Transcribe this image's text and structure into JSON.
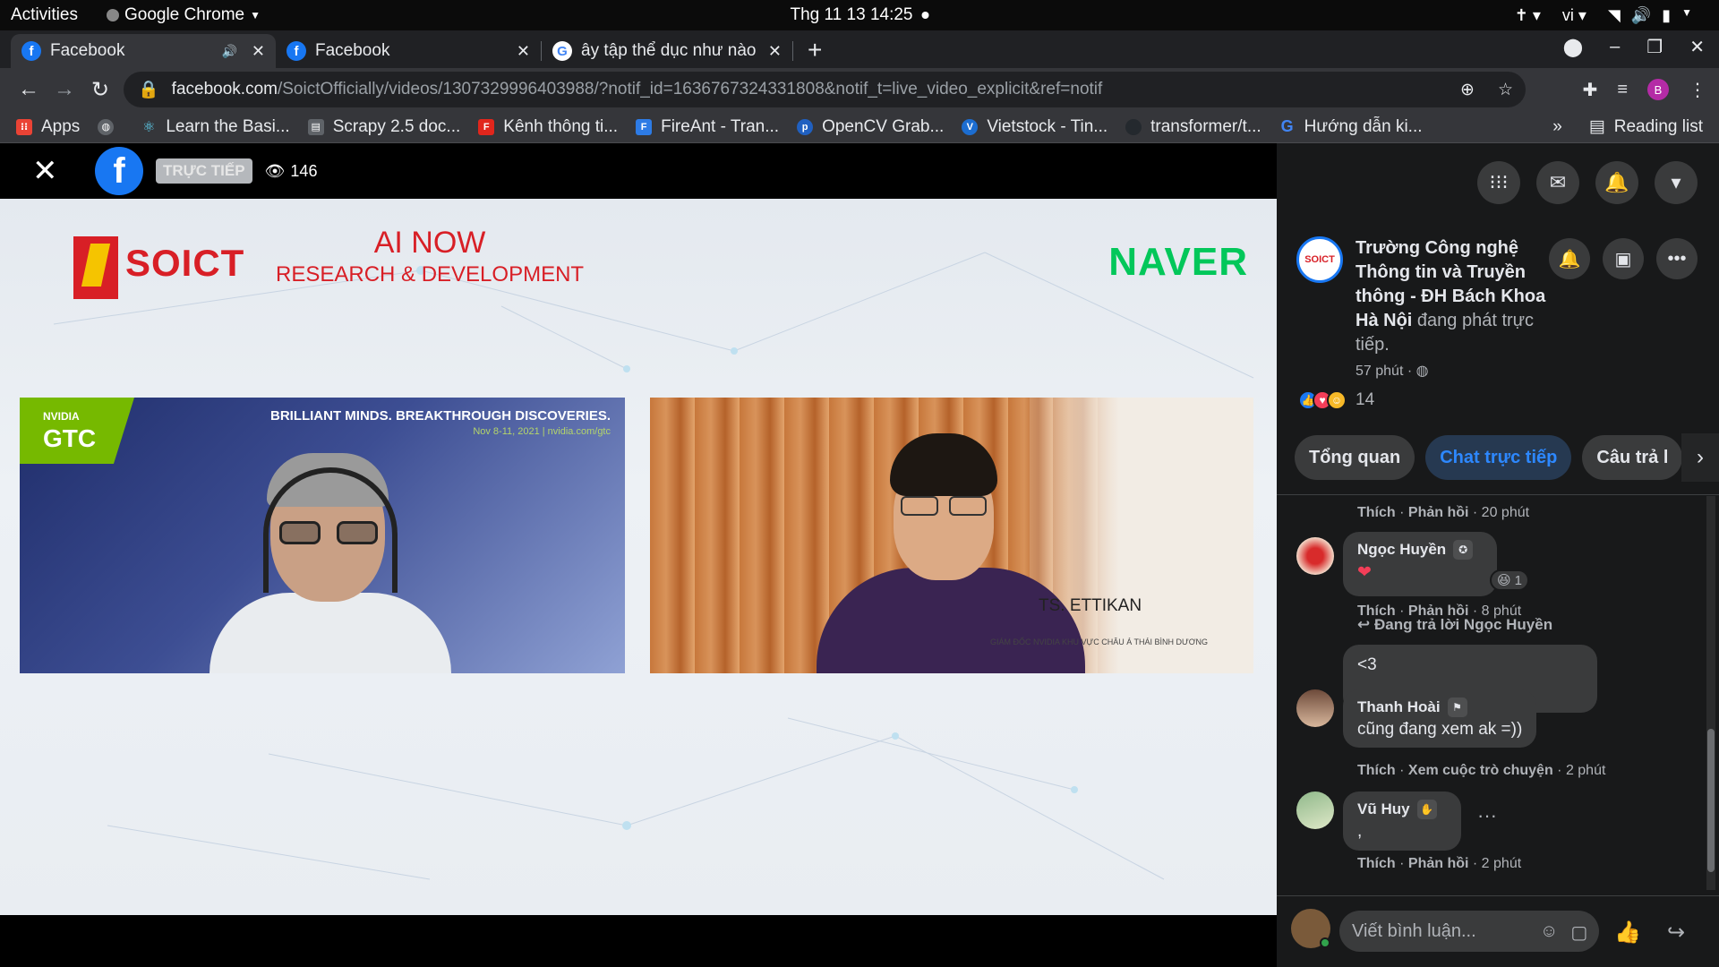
{
  "system": {
    "activities": "Activities",
    "app": "Google Chrome",
    "clock": "Thg 11 13  14:25",
    "lang": "vi"
  },
  "tabs": [
    {
      "title": "Facebook",
      "active": true
    },
    {
      "title": "Facebook",
      "active": false
    },
    {
      "title": "ây tập thể dục như nào l",
      "active": false
    }
  ],
  "address": {
    "host": "facebook.com",
    "path": "/SoictOfficially/videos/1307329996403988/?notif_id=1636767324331808&notif_t=live_video_explicit&ref=notif"
  },
  "profile_initial": "B",
  "bookmarks": [
    {
      "label": "Apps",
      "color": "#ea4335"
    },
    {
      "label": "",
      "color": "#5f6368"
    },
    {
      "label": "Learn the Basi...",
      "color": "#61dafb"
    },
    {
      "label": "Scrapy 2.5 doc...",
      "color": "#5f6368"
    },
    {
      "label": "Kênh thông ti...",
      "color": "#e1261c"
    },
    {
      "label": "FireAnt - Tran...",
      "color": "#2d7be5"
    },
    {
      "label": "OpenCV Grab...",
      "color": "#2060c0"
    },
    {
      "label": "Vietstock - Tin...",
      "color": "#1c6dd0"
    },
    {
      "label": "transformer/t...",
      "color": "#24292e"
    },
    {
      "label": "Hướng dẫn ki...",
      "color": "#4285f4"
    }
  ],
  "reading_list": "Reading list",
  "video": {
    "live_label": "TRỰC TIẾP",
    "viewers": "146",
    "soict": "SOICT",
    "ainow_line1": "AI NOW",
    "ainow_line2": "RESEARCH & DEVELOPMENT",
    "naver": "NAVER",
    "gtc_nvidia": "NVIDIA",
    "gtc": "GTC",
    "brilliant": "BRILLIANT MINDS. BREAKTHROUGH DISCOVERIES.",
    "brilliant_sub": "Nov 8-11, 2021 | nvidia.com/gtc",
    "speaker_name": "TS. ETTIKAN",
    "speaker_title": "GIÁM ĐỐC NVIDIA KHU VỰC CHÂU Á THÁI BÌNH DƯƠNG"
  },
  "page": {
    "name": "Trường Công nghệ Thông tin và Truyền thông - ĐH Bách Khoa Hà Nội",
    "status": "đang phát trực tiếp.",
    "time": "57 phút ·",
    "reaction_count": "14",
    "avatar_text": "SOICT"
  },
  "sidebar_tabs": [
    "Tổng quan",
    "Chat trực tiếp",
    "Câu trả l"
  ],
  "comments": {
    "top_meta": {
      "like": "Thích",
      "reply": "Phản hồi",
      "time": "20 phút"
    },
    "ngoc_huyen": {
      "name": "Ngọc Huyền",
      "text": "❤",
      "react_count": "1",
      "like": "Thích",
      "reply": "Phản hồi",
      "time": "8 phút"
    },
    "replying_to": "Đang trả lời Ngọc Huyền",
    "reply_bubble": "<3",
    "thanh_hoai": {
      "name": "Thanh Hoài",
      "text": "cũng đang xem ak =))",
      "like": "Thích",
      "view": "Xem cuộc trò chuyện",
      "time": "2 phút"
    },
    "vu_huy": {
      "name": "Vũ Huy",
      "text": ",",
      "like": "Thích",
      "reply": "Phản hồi",
      "time": "2 phút"
    }
  },
  "composer": {
    "placeholder": "Viết bình luận..."
  }
}
